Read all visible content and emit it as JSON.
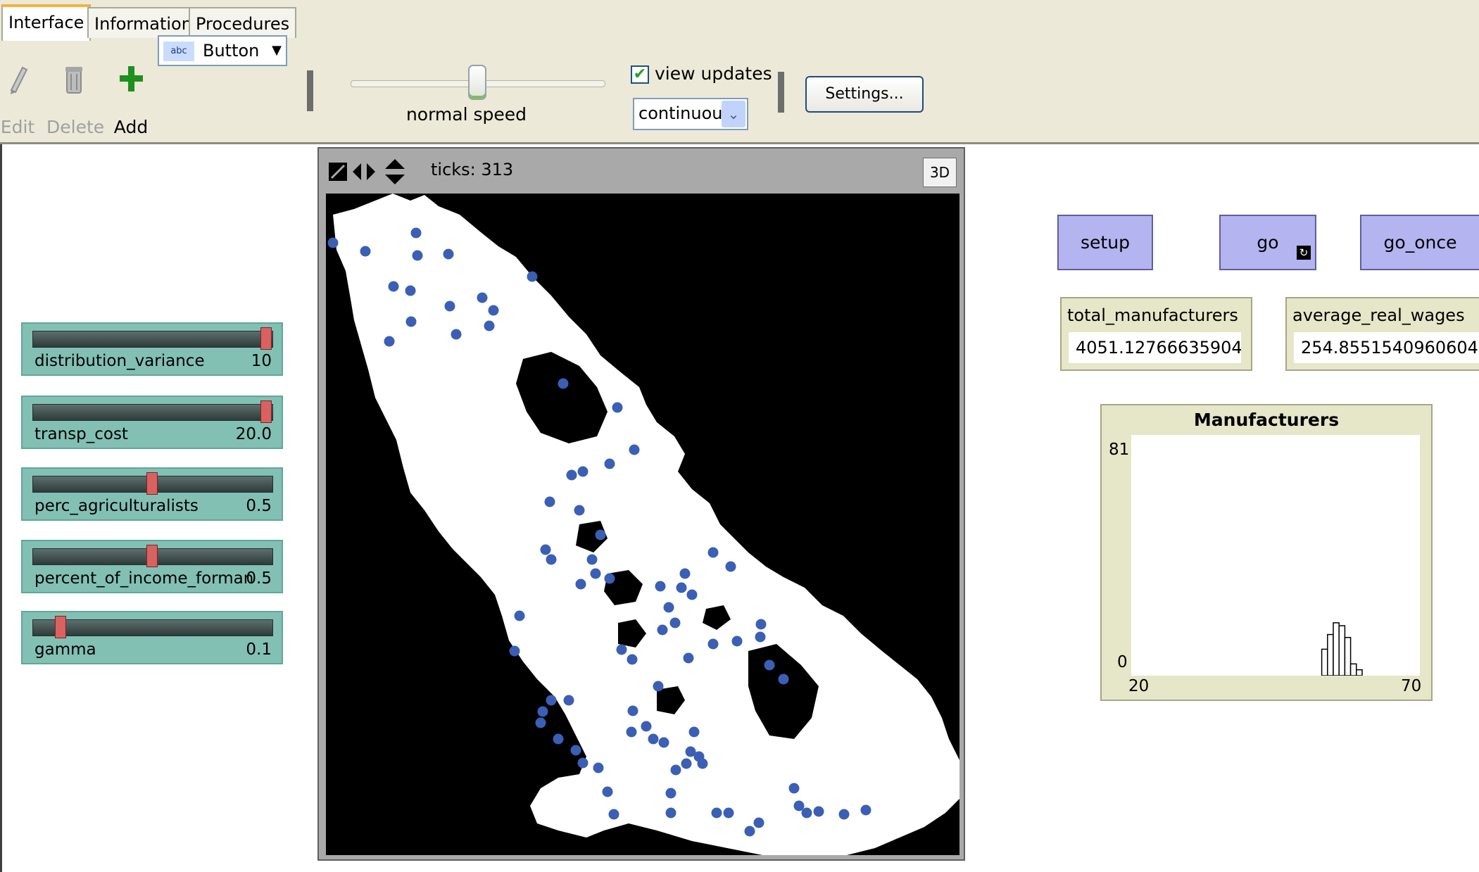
{
  "tabs": [
    "Interface",
    "Information",
    "Procedures"
  ],
  "toolbar": {
    "edit_label": "Edit",
    "delete_label": "Delete",
    "add_label": "Add",
    "widget_type": "Button",
    "speed_label": "normal speed",
    "speed_fraction": 0.5,
    "view_updates_label": "view updates",
    "view_updates_checked": true,
    "update_mode": "continuous",
    "settings_label": "Settings..."
  },
  "sliders": [
    {
      "name": "distribution_variance",
      "value": "10",
      "fraction": 1.0
    },
    {
      "name": "transp_cost",
      "value": "20.0",
      "fraction": 1.0
    },
    {
      "name": "perc_agriculturalists",
      "value": "0.5",
      "fraction": 0.5
    },
    {
      "name": "percent_of_income_forman",
      "value": "0.5",
      "fraction": 0.5
    },
    {
      "name": "gamma",
      "value": "0.1",
      "fraction": 0.1
    }
  ],
  "view": {
    "ticks_label": "ticks: 313",
    "btn_3d": "3D",
    "background_color": "#000000",
    "land_color": "#ffffff",
    "turtle_color": "#3a5fb4"
  },
  "buttons": {
    "setup": "setup",
    "go": "go",
    "go_once": "go_once"
  },
  "monitors": [
    {
      "name": "total_manufacturers",
      "value": "4051.12766635904"
    },
    {
      "name": "average_real_wages",
      "value": "254.8551540960604"
    }
  ],
  "plot": {
    "title": "Manufacturers",
    "y_max_label": "81",
    "y_min_label": "0",
    "x_min_label": "20",
    "x_max_label": "70"
  },
  "chart_data": {
    "type": "bar",
    "title": "Manufacturers",
    "xlim": [
      20,
      70
    ],
    "ylim": [
      0,
      81
    ],
    "x": [
      53,
      54,
      55,
      56,
      57,
      58,
      59
    ],
    "values": [
      9,
      14,
      18,
      17,
      13,
      4,
      2
    ]
  }
}
